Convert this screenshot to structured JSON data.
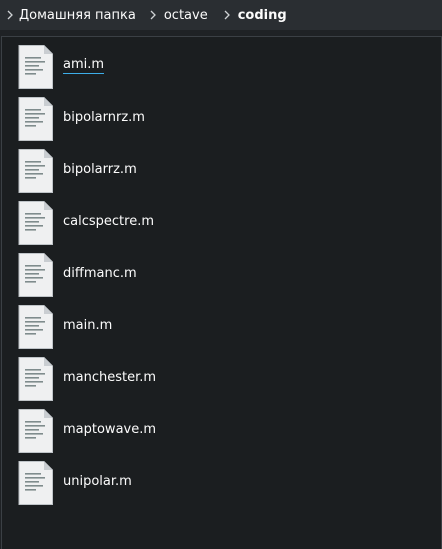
{
  "breadcrumb": {
    "items": [
      {
        "label": "Домашняя папка"
      },
      {
        "label": "octave"
      },
      {
        "label": "coding"
      }
    ]
  },
  "files": [
    {
      "name": "ami.m"
    },
    {
      "name": "bipolarnrz.m"
    },
    {
      "name": "bipolarrz.m"
    },
    {
      "name": "calcspectre.m"
    },
    {
      "name": "diffmanc.m"
    },
    {
      "name": "main.m"
    },
    {
      "name": "manchester.m"
    },
    {
      "name": "maptowave.m"
    },
    {
      "name": "unipolar.m"
    }
  ],
  "colors": {
    "background": "#1b1e20",
    "toolbar": "#2a2e32",
    "text": "#fcfcfc",
    "focus_underline": "#3daee9"
  },
  "icons": {
    "breadcrumb_separator": "chevron-right-icon",
    "file": "text-document-icon"
  }
}
